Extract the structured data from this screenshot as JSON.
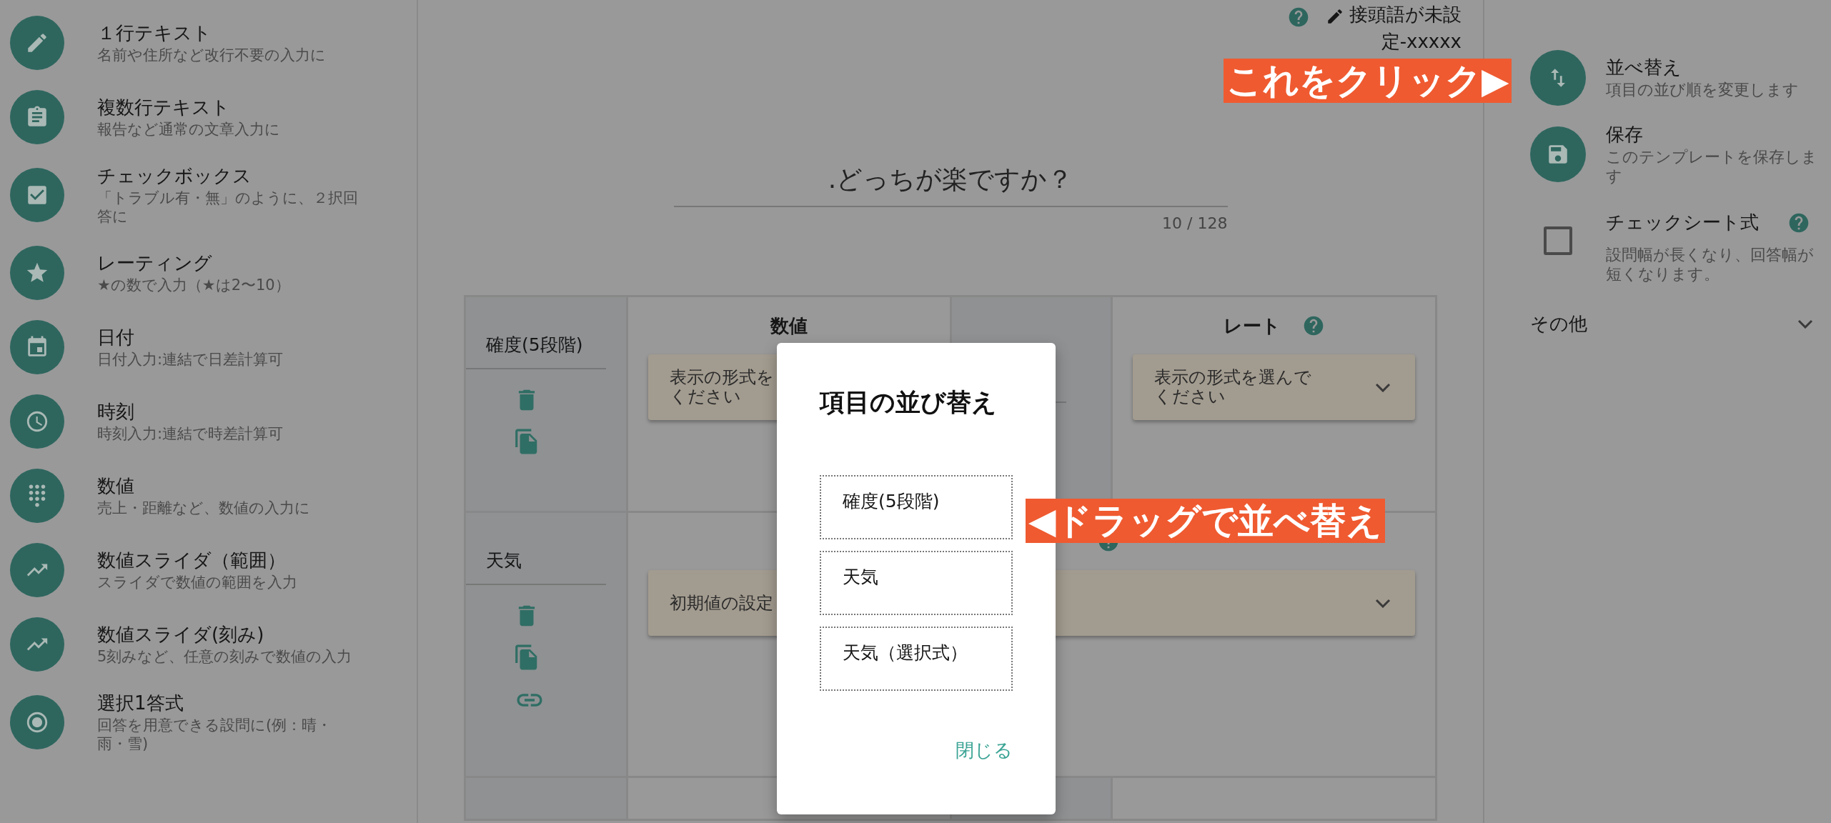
{
  "sidebar": {
    "items": [
      {
        "title": "１行テキスト",
        "description": "名前や住所など改行不要の入力に"
      },
      {
        "title": "複数行テキスト",
        "description": "報告など通常の文章入力に"
      },
      {
        "title": "チェックボックス",
        "description": "「トラブル有・無」のように、２択回答に"
      },
      {
        "title": "レーティング",
        "description": "★の数で入力（★は2〜10）"
      },
      {
        "title": "日付",
        "description": "日付入力:連結で日差計算可"
      },
      {
        "title": "時刻",
        "description": "時刻入力:連結で時差計算可"
      },
      {
        "title": "数値",
        "description": "売上・距離など、数値の入力に"
      },
      {
        "title": "数値スライダ（範囲）",
        "description": "スライダで数値の範囲を入力"
      },
      {
        "title": "数値スライダ(刻み)",
        "description": "5刻みなど、任意の刻みで数値の入力"
      },
      {
        "title": "選択1答式",
        "description": "回答を用意できる設問に(例：晴・雨・雪)"
      }
    ]
  },
  "header": {
    "prefix_link": "接頭語が未設定-xxxxx"
  },
  "question": {
    "title": ".どっちが楽ですか？",
    "counter": "10 / 128"
  },
  "table": {
    "rows": [
      {
        "label": "確度(5段階)",
        "has_link": false,
        "cells": [
          {
            "kind": "select",
            "header": "数値",
            "help": false,
            "lines": [
              "表示の形式を",
              "ください"
            ]
          },
          {
            "kind": "input"
          },
          {
            "kind": "select",
            "header": "レート",
            "help": true,
            "lines": [
              "表示の形式を選んで",
              "ください"
            ]
          }
        ]
      },
      {
        "label": "天気",
        "has_link": true,
        "cells": [
          {
            "kind": "wide_select",
            "help": true,
            "lines": [
              "初期値の設定"
            ]
          }
        ]
      },
      {
        "cells": []
      }
    ]
  },
  "dialog": {
    "title": "項目の並び替え",
    "items": [
      "確度(5段階)",
      "天気",
      "天気（選択式）"
    ],
    "close": "閉じる"
  },
  "annotations": [
    {
      "kind": "click_hint",
      "text": "これをクリック▶"
    },
    {
      "kind": "drag_hint",
      "text": "◀ドラッグで並べ替え"
    }
  ],
  "right_panel": {
    "items": [
      {
        "kind": "action",
        "title": "並べ替え",
        "description": "項目の並び順を変更します"
      },
      {
        "kind": "action",
        "title": "保存",
        "description": "このテンプレートを保存します"
      },
      {
        "kind": "checkbox",
        "checked": false,
        "title": "チェックシート式",
        "help": true,
        "description": "設問幅が長くなり、回答幅が短くなります。"
      }
    ],
    "section": {
      "title": "その他",
      "expanded": false
    }
  }
}
